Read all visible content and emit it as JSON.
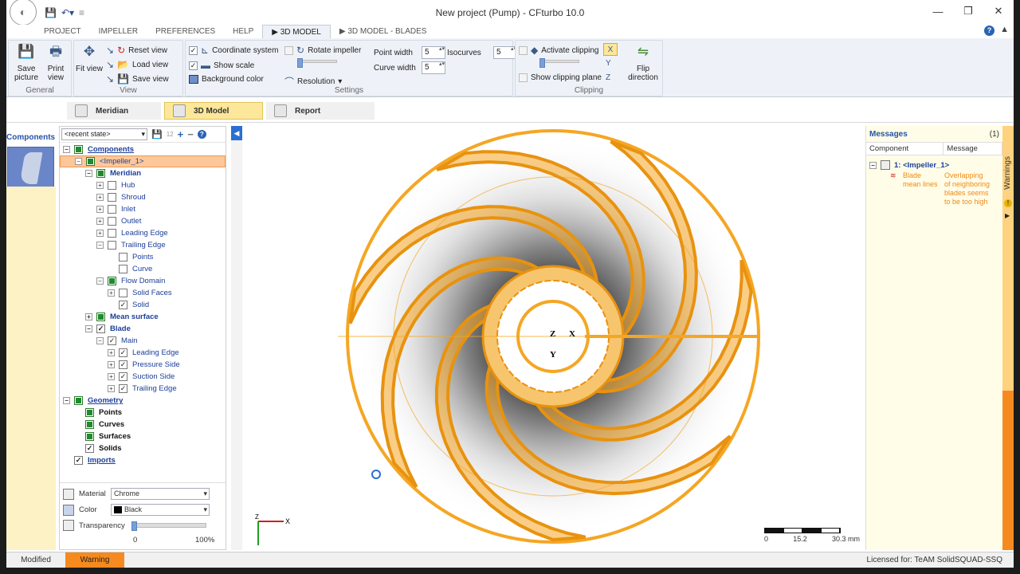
{
  "window": {
    "title": "New project (Pump) - CFturbo 10.0",
    "controls": [
      "—",
      "❐",
      "✕"
    ]
  },
  "tabs": [
    "PROJECT",
    "IMPELLER",
    "PREFERENCES",
    "HELP",
    "▶ 3D MODEL",
    "▶ 3D MODEL - BLADES"
  ],
  "ribbon": {
    "general": {
      "caption": "General",
      "save_picture": "Save picture",
      "print_view": "Print view"
    },
    "view": {
      "caption": "View",
      "fit_view": "Fit view",
      "reset_view": "Reset view",
      "load_view": "Load view",
      "save_view": "Save view"
    },
    "settings": {
      "caption": "Settings",
      "coordinate_system": "Coordinate system",
      "show_scale": "Show scale",
      "background_color": "Background color",
      "rotate_impeller": "Rotate impeller",
      "resolution": "Resolution",
      "point_width_label": "Point width",
      "point_width_value": "5",
      "curve_width_label": "Curve width",
      "curve_width_value": "5",
      "isocurves_label": "Isocurves",
      "isocurves_value": "5"
    },
    "clipping": {
      "caption": "Clipping",
      "activate_clipping": "Activate clipping",
      "show_clipping_plane": "Show clipping plane",
      "flip_direction": "Flip direction"
    }
  },
  "view_tabs": [
    "Meridian",
    "3D Model",
    "Report"
  ],
  "components": {
    "header": "Components"
  },
  "tree": {
    "state_dropdown": "<recent state>",
    "items": [
      {
        "label": "Components"
      },
      {
        "label": "<Impeller_1>"
      },
      {
        "label": "Meridian"
      },
      {
        "label": "Hub"
      },
      {
        "label": "Shroud"
      },
      {
        "label": "Inlet"
      },
      {
        "label": "Outlet"
      },
      {
        "label": "Leading Edge"
      },
      {
        "label": "Trailing Edge"
      },
      {
        "label": "Points"
      },
      {
        "label": "Curve"
      },
      {
        "label": "Flow Domain"
      },
      {
        "label": "Solid Faces"
      },
      {
        "label": "Solid"
      },
      {
        "label": "Mean surface"
      },
      {
        "label": "Blade"
      },
      {
        "label": "Main"
      },
      {
        "label": "Leading Edge"
      },
      {
        "label": "Pressure Side"
      },
      {
        "label": "Suction Side"
      },
      {
        "label": "Trailing Edge"
      },
      {
        "label": "Geometry"
      },
      {
        "label": "Points"
      },
      {
        "label": "Curves"
      },
      {
        "label": "Surfaces"
      },
      {
        "label": "Solids"
      },
      {
        "label": "Imports"
      }
    ]
  },
  "properties": {
    "material_label": "Material",
    "material_value": "Chrome",
    "color_label": "Color",
    "color_value": "Black",
    "transparency_label": "Transparency",
    "transparency_value": 0.0,
    "slider_min": "0",
    "slider_max": "100%"
  },
  "viewport": {
    "blade_count": 7,
    "axis_labels": {
      "x": "X",
      "y": "Y",
      "z": "Z"
    },
    "triad_labels": {
      "x": "X",
      "z": "Z"
    },
    "scale_labels": [
      "0",
      "15.2",
      "30.3 mm"
    ],
    "colors": {
      "blade": "#f5a623",
      "blade_dark": "#e8920f",
      "shadow": "#2a2a2a"
    }
  },
  "messages": {
    "header": "Messages",
    "count": "(1)",
    "col_component": "Component",
    "col_message": "Message",
    "row_component": "1: <Impeller_1>",
    "detail_component": "Blade mean lines",
    "detail_message": "Overlapping of neighboring blades seems to be too high",
    "warnings_tab": "Warnings"
  },
  "statusbar": {
    "modified": "Modified",
    "warning": "Warning",
    "license": "Licensed for: TeAM SolidSQUAD-SSQ"
  }
}
